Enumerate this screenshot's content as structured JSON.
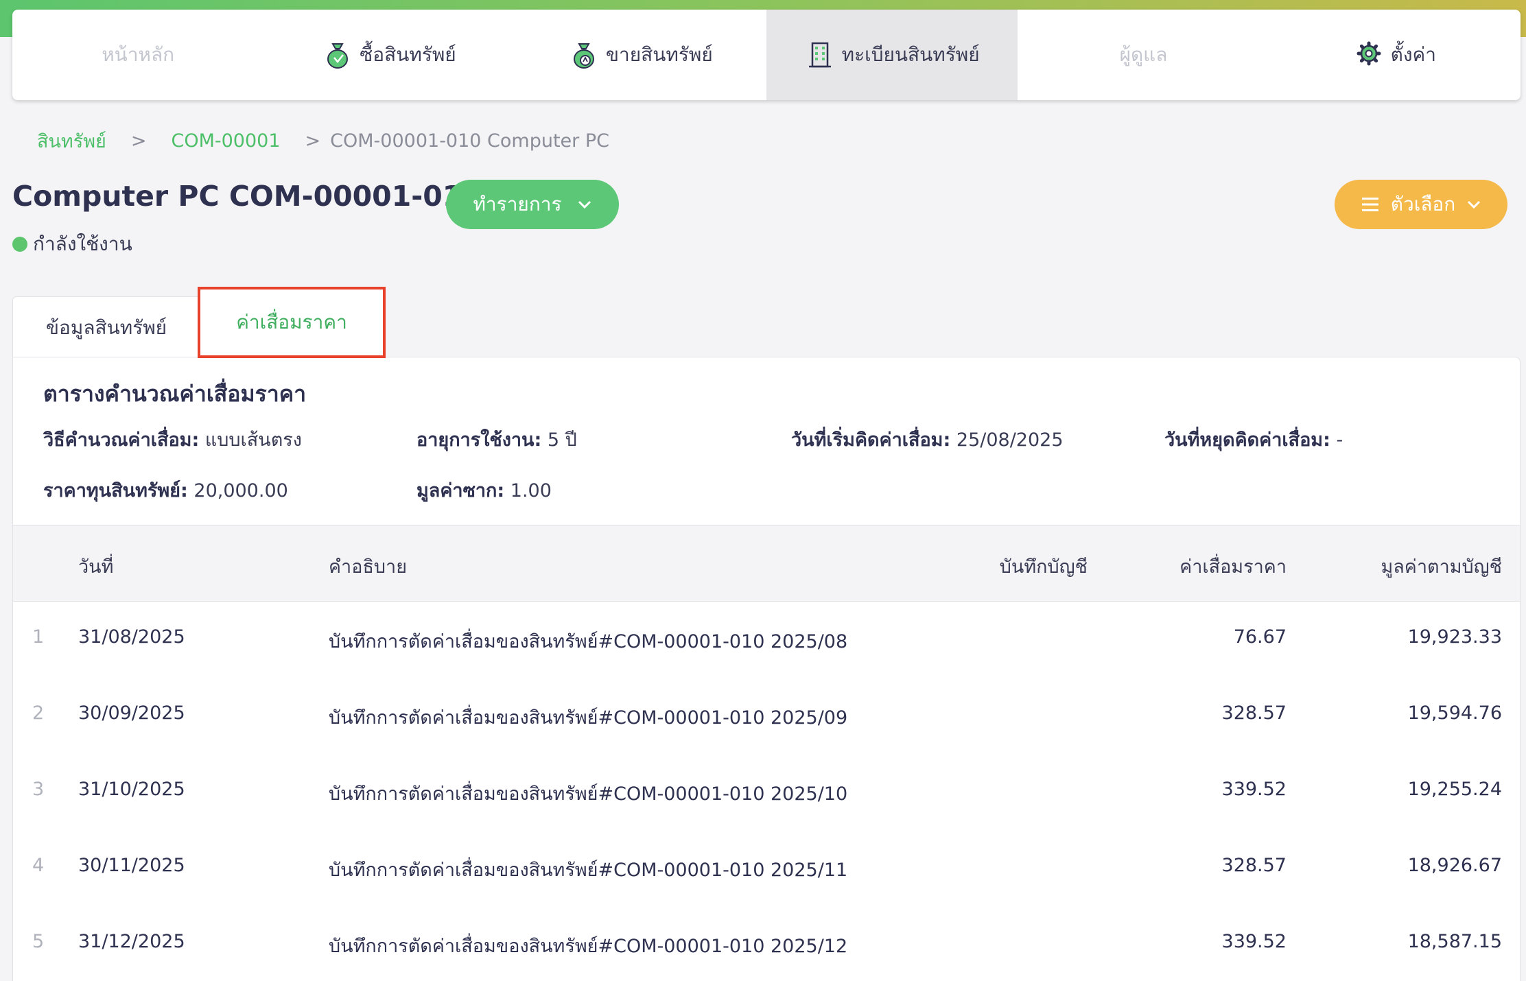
{
  "nav": {
    "items": [
      {
        "label": "หน้าหลัก",
        "icon": "",
        "state": "muted"
      },
      {
        "label": "ซื้อสินทรัพย์",
        "icon": "money-bag-icon",
        "state": "normal"
      },
      {
        "label": "ขายสินทรัพย์",
        "icon": "money-bag-icon",
        "state": "normal"
      },
      {
        "label": "ทะเบียนสินทรัพย์",
        "icon": "building-icon",
        "state": "active"
      },
      {
        "label": "ผู้ดูแล",
        "icon": "",
        "state": "muted"
      },
      {
        "label": "ตั้งค่า",
        "icon": "gear-icon",
        "state": "normal"
      }
    ]
  },
  "breadcrumb": {
    "root": "สินทรัพย์",
    "sep": ">",
    "parent": "COM-00001",
    "current": "COM-00001-010 Computer PC"
  },
  "header": {
    "title": "Computer PC COM-00001-010",
    "status": "กำลังใช้งาน",
    "action_label": "ทำรายการ",
    "options_label": "ตัวเลือก"
  },
  "tabs": {
    "info": "ข้อมูลสินทรัพย์",
    "depreciation": "ค่าเสื่อมราคา"
  },
  "section": {
    "title": "ตารางคำนวณค่าเสื่อมราคา",
    "method_label": "วิธีคำนวณค่าเสื่อม:",
    "method_value": "แบบเส้นตรง",
    "life_label": "อายุการใช้งาน:",
    "life_value": "5 ปี",
    "start_label": "วันที่เริ่มคิดค่าเสื่อม:",
    "start_value": "25/08/2025",
    "stop_label": "วันที่หยุดคิดค่าเสื่อม:",
    "stop_value": "-",
    "cost_label": "ราคาทุนสินทรัพย์:",
    "cost_value": "20,000.00",
    "salvage_label": "มูลค่าซาก:",
    "salvage_value": "1.00"
  },
  "table": {
    "headers": {
      "date": "วันที่",
      "description": "คำอธิบาย",
      "journal": "บันทึกบัญชี",
      "depreciation": "ค่าเสื่อมราคา",
      "book_value": "มูลค่าตามบัญชี"
    },
    "rows": [
      {
        "idx": "1",
        "date": "31/08/2025",
        "description": "บันทึกการตัดค่าเสื่อมของสินทรัพย์#COM-00001-010 2025/08",
        "journal": "",
        "depreciation": "76.67",
        "book_value": "19,923.33"
      },
      {
        "idx": "2",
        "date": "30/09/2025",
        "description": "บันทึกการตัดค่าเสื่อมของสินทรัพย์#COM-00001-010 2025/09",
        "journal": "",
        "depreciation": "328.57",
        "book_value": "19,594.76"
      },
      {
        "idx": "3",
        "date": "31/10/2025",
        "description": "บันทึกการตัดค่าเสื่อมของสินทรัพย์#COM-00001-010 2025/10",
        "journal": "",
        "depreciation": "339.52",
        "book_value": "19,255.24"
      },
      {
        "idx": "4",
        "date": "30/11/2025",
        "description": "บันทึกการตัดค่าเสื่อมของสินทรัพย์#COM-00001-010 2025/11",
        "journal": "",
        "depreciation": "328.57",
        "book_value": "18,926.67"
      },
      {
        "idx": "5",
        "date": "31/12/2025",
        "description": "บันทึกการตัดค่าเสื่อมของสินทรัพย์#COM-00001-010 2025/12",
        "journal": "",
        "depreciation": "339.52",
        "book_value": "18,587.15"
      }
    ]
  },
  "colors": {
    "brand_green": "#5cc877",
    "accent_orange": "#f5b94a",
    "highlight_red": "#e8412c"
  }
}
